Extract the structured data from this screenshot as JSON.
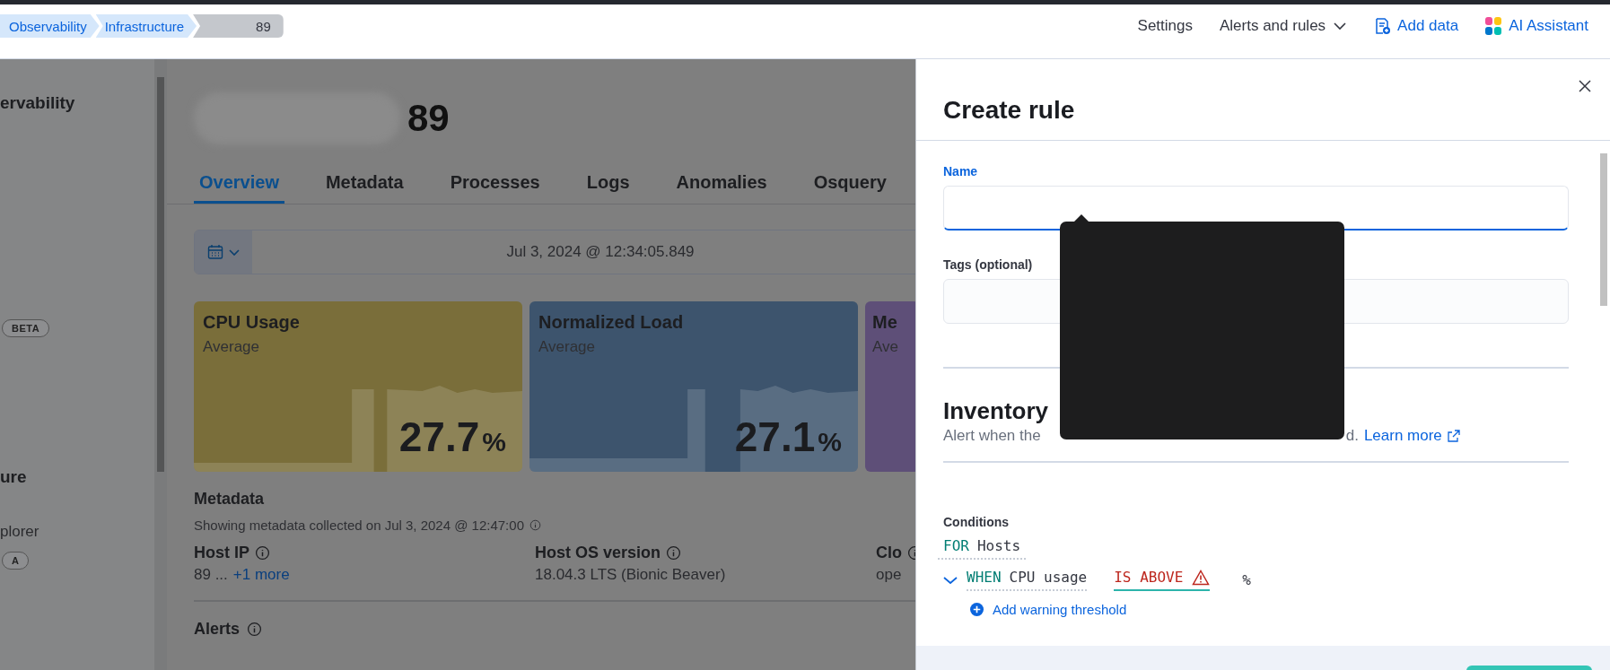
{
  "breadcrumbs": [
    {
      "label": "Observability",
      "selected": false
    },
    {
      "label": "Infrastructure",
      "selected": false
    },
    {
      "label": "89",
      "selected": true
    }
  ],
  "header_actions": [
    {
      "kind": "plain",
      "label": "Settings"
    },
    {
      "kind": "dropdown",
      "label": "Alerts and rules"
    },
    {
      "kind": "add",
      "label": "Add data"
    },
    {
      "kind": "assistant",
      "label": "AI Assistant"
    }
  ],
  "sidebar": {
    "items": [
      {
        "kind": "heading",
        "label": "ervability"
      },
      {
        "kind": "badge",
        "label": "BETA"
      },
      {
        "kind": "heading",
        "label": "ure"
      },
      {
        "kind": "link",
        "label": "plorer"
      },
      {
        "kind": "badge",
        "label": "A"
      }
    ]
  },
  "host": {
    "title": "89",
    "tabs": [
      {
        "label": "Overview",
        "selected": true
      },
      {
        "label": "Metadata",
        "selected": false
      },
      {
        "label": "Processes",
        "selected": false
      },
      {
        "label": "Logs",
        "selected": false
      },
      {
        "label": "Anomalies",
        "selected": false
      },
      {
        "label": "Osquery",
        "selected": false
      }
    ],
    "date_picker": {
      "value": "Jul 3, 2024 @ 12:34:05.849"
    },
    "kpis": [
      {
        "title": "CPU Usage",
        "subtitle": "Average",
        "value": "27.7",
        "unit": "%",
        "color": "#7a6e3a"
      },
      {
        "title": "Normalized Load",
        "subtitle": "Average",
        "value": "27.1",
        "unit": "%",
        "color": "#3d546d"
      },
      {
        "title": "Me",
        "subtitle": "Ave",
        "color": "#5e4f78"
      }
    ],
    "metadata": {
      "title": "Metadata",
      "note": "Showing metadata collected on Jul 3, 2024 @ 12:47:00",
      "fields": [
        {
          "label": "Host IP",
          "value": "89 ...",
          "link": "+1 more"
        },
        {
          "label": "Host OS version",
          "value": "18.04.3 LTS (Bionic Beaver)"
        },
        {
          "label": "Clo",
          "value": "ope"
        }
      ]
    },
    "alerts": {
      "title": "Alerts"
    }
  },
  "flyout": {
    "title": "Create rule",
    "name_field": {
      "label": "Name",
      "focused": true
    },
    "tags_field": {
      "label": "Tags (optional)"
    },
    "rule_type": {
      "title": "Inventory",
      "description_start": "Alert when the",
      "description_end": "d.",
      "link": "Learn more"
    },
    "conditions": {
      "label": "Conditions",
      "for_keyword": "FOR",
      "for_value": "Hosts",
      "criteria": [
        {
          "expanded": true,
          "when_keyword": "WHEN",
          "metric": "CPU usage",
          "comparator": "IS ABOVE",
          "invalid": true,
          "unit": "%"
        }
      ],
      "add_link": "Add warning threshold"
    }
  }
}
